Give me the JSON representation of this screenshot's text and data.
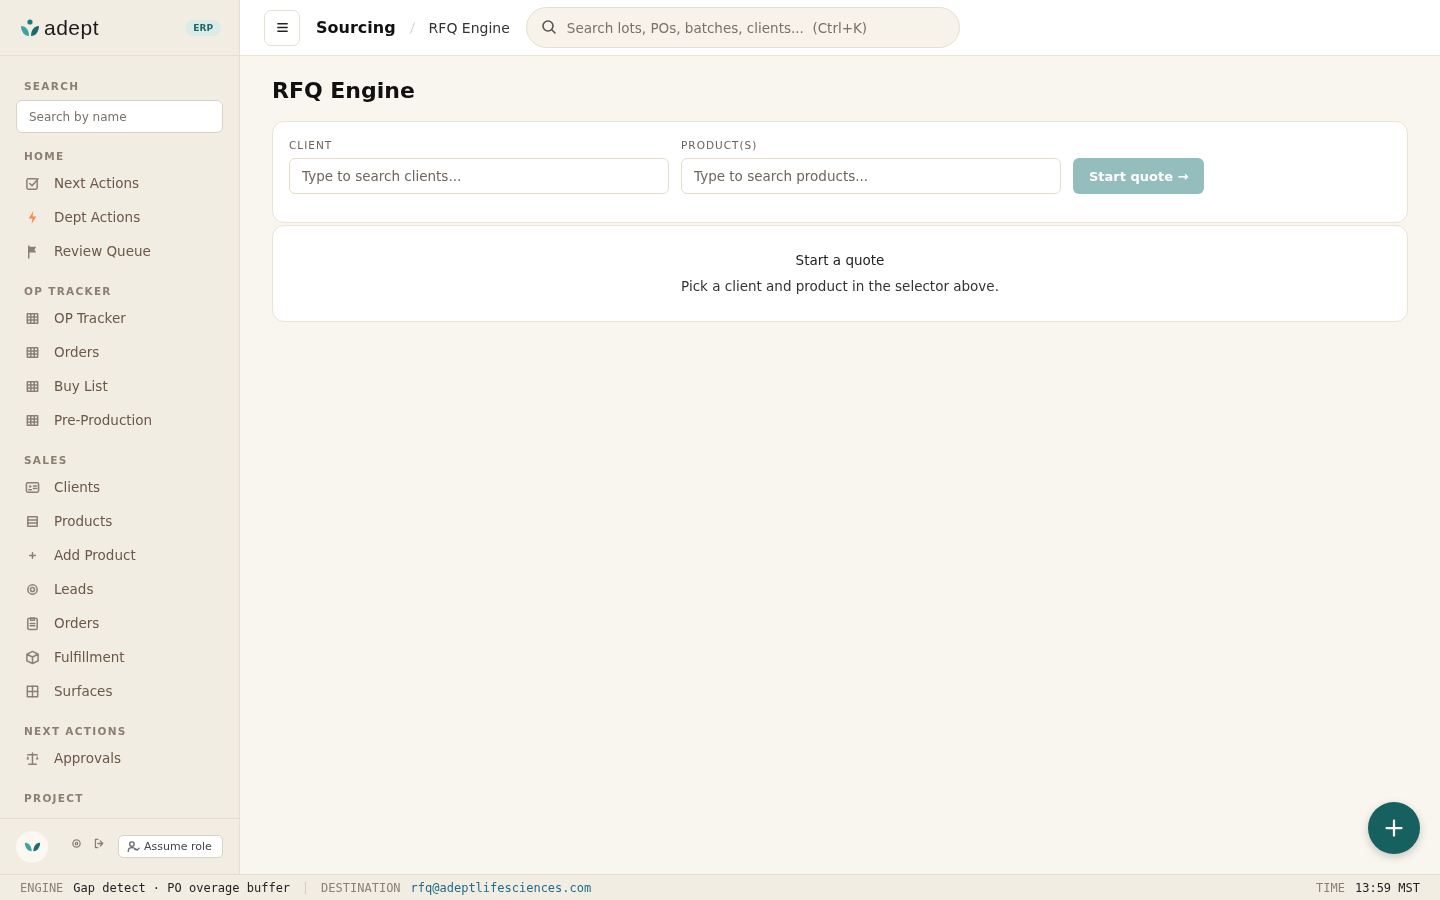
{
  "brand": {
    "name": "adept",
    "badge": "ERP"
  },
  "sidebar": {
    "search": {
      "label": "SEARCH",
      "placeholder": "Search by name"
    },
    "sections": [
      {
        "title": "HOME",
        "items": [
          {
            "label": "Next Actions",
            "kind": "check"
          },
          {
            "label": "Dept Actions",
            "kind": "bolt"
          },
          {
            "label": "Review Queue",
            "kind": "flag"
          }
        ]
      },
      {
        "title": "OP TRACKER",
        "items": [
          {
            "label": "OP Tracker",
            "kind": "table"
          },
          {
            "label": "Orders",
            "kind": "table"
          },
          {
            "label": "Buy List",
            "kind": "table"
          },
          {
            "label": "Pre-Production",
            "kind": "table"
          }
        ]
      },
      {
        "title": "SALES",
        "items": [
          {
            "label": "Clients",
            "kind": "card"
          },
          {
            "label": "Products",
            "kind": "list"
          },
          {
            "label": "Add Product",
            "kind": "plus"
          },
          {
            "label": "Leads",
            "kind": "target"
          },
          {
            "label": "Orders",
            "kind": "clipboard"
          },
          {
            "label": "Fulfillment",
            "kind": "box"
          },
          {
            "label": "Surfaces",
            "kind": "grid"
          }
        ]
      },
      {
        "title": "NEXT ACTIONS",
        "items": [
          {
            "label": "Approvals",
            "kind": "scale"
          }
        ]
      },
      {
        "title": "PROJECT"
      }
    ],
    "footer": {
      "assume_role": "Assume role"
    }
  },
  "topbar": {
    "breadcrumb": [
      "Sourcing",
      "RFQ Engine"
    ],
    "search_placeholder": "Search lots, POs, batches, clients...  (Ctrl+K)"
  },
  "page": {
    "title": "RFQ Engine",
    "selector": {
      "client": {
        "label": "CLIENT",
        "placeholder": "Type to search clients..."
      },
      "products": {
        "label": "PRODUCT(S)",
        "placeholder": "Type to search products..."
      },
      "button": {
        "label": "Start quote →",
        "disabled": true
      }
    },
    "empty": {
      "title": "Start a quote",
      "message": "Pick a client and product in the selector above."
    }
  },
  "status_bar": {
    "engine_label": "ENGINE",
    "engine": "Gap detect · PO overage buffer",
    "destination_label": "DESTINATION",
    "destination": "rfq@adeptlifesciences.com",
    "time_label": "TIME",
    "time": "13:59 MST"
  }
}
